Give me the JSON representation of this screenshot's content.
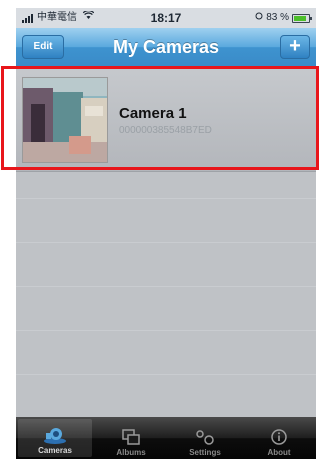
{
  "status_bar": {
    "carrier": "中華電信",
    "time": "18:17",
    "battery": "83 %",
    "battery_level": 0.83
  },
  "nav_bar": {
    "edit_label": "Edit",
    "title": "My Cameras",
    "add_label": "+"
  },
  "cameras": [
    {
      "name": "Camera 1",
      "id": "000000385548B7ED"
    }
  ],
  "tab_bar": {
    "tabs": [
      {
        "label": "Cameras",
        "icon": "camera-icon",
        "active": true
      },
      {
        "label": "Albums",
        "icon": "albums-icon",
        "active": false
      },
      {
        "label": "Settings",
        "icon": "settings-icon",
        "active": false
      },
      {
        "label": "About",
        "icon": "info-icon",
        "active": false
      }
    ]
  },
  "colors": {
    "nav_blue": "#3e93cf",
    "highlight_red": "#e8161b",
    "battery_green": "#4cbf2a"
  }
}
